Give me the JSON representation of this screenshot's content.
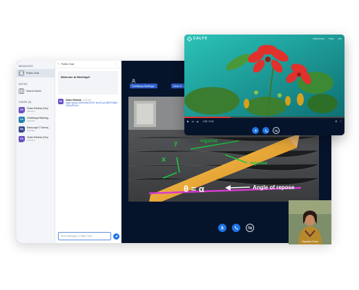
{
  "sidebar": {
    "messages_heading": "MESSAGES",
    "public_chat_label": "Public Chat",
    "notes_heading": "NOTES",
    "shared_notes_label": "Shared Notes",
    "users_heading": "USERS (5)",
    "users": [
      {
        "initials": "Ch",
        "name": "Charu Rohinia (You)",
        "role": "Janurfest",
        "color": "#6b4fc4"
      },
      {
        "initials": "Ch",
        "name": "Chaithanya Ramling...",
        "role": "Janurfest",
        "color": "#1f7fae"
      },
      {
        "initials": "Ra",
        "name": "Ramuchyn77 Dervis...",
        "role": "Janurfest",
        "color": "#3a4a8c"
      },
      {
        "initials": "Ch",
        "name": "Charu Rohinia (You)",
        "role": "Janurfest",
        "color": "#6b4fc4"
      }
    ]
  },
  "chat": {
    "title": "Public Chat",
    "welcome": "Welcome to Meeting2!",
    "message": {
      "initials": "Ch",
      "author": "Charu Rohinia",
      "time": "3:29 AM",
      "link": "https://youtu.be/SnSMC0PbY be=IFLpXJBOFHfAWCBDzJPbOe"
    },
    "input_placeholder": "Send message to Public Chat"
  },
  "stage": {
    "chips": [
      "Chaithanya Ramlinga...",
      "Charu R..."
    ],
    "slide": {
      "force_label_1": "mgsinα",
      "force_label_2": "mgcosα",
      "force_label_3": "x",
      "force_label_4": "y",
      "equation": "θ = α",
      "arrow_text": "Angle of repose"
    },
    "camera_caption": "Raashtra Tiwari"
  },
  "popup": {
    "brand": "CALYX",
    "top_actions": [
      "Media Panel",
      "Share",
      "Exit"
    ],
    "timecode": "1:36 / 5:31"
  },
  "colors": {
    "accent_blue": "#1d74e8",
    "stage_bg": "#06142b",
    "sidebar_bg": "#f3f5f8",
    "chip_blue": "#2d5ec9"
  }
}
